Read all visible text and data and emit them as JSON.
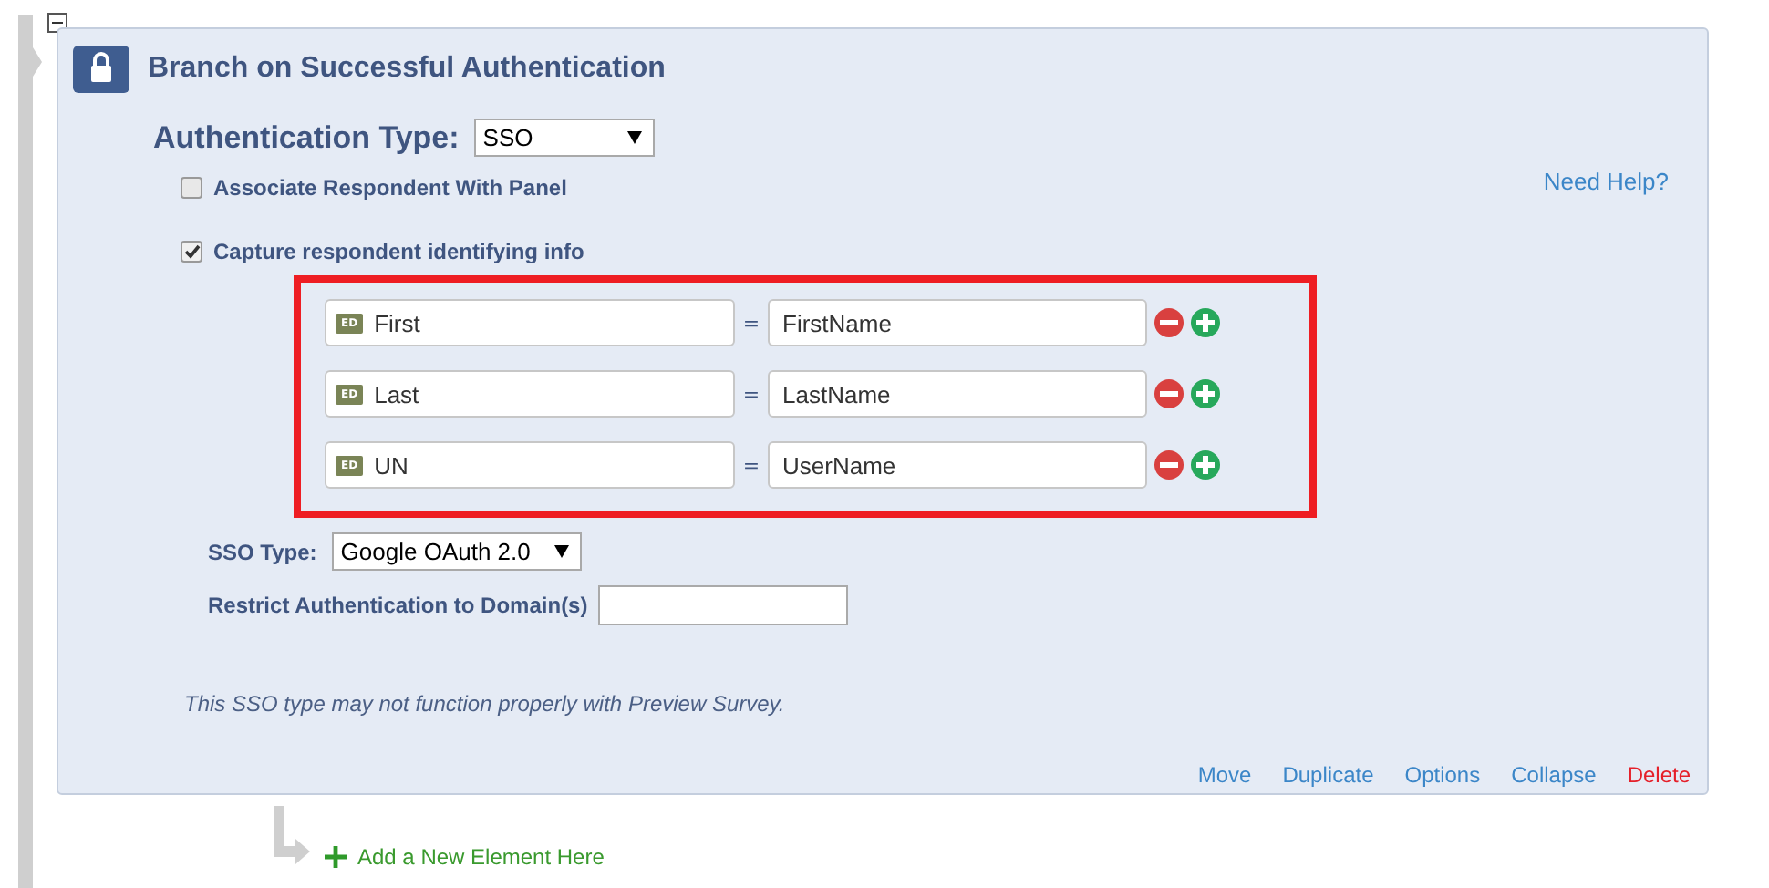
{
  "block": {
    "title": "Branch on Successful Authentication",
    "expanded": true,
    "authentication_type": {
      "label": "Authentication Type:",
      "value": "SSO"
    },
    "need_help": "Need Help?",
    "options": [
      {
        "label": "Associate Respondent With Panel",
        "checked": false
      },
      {
        "label": "Capture respondent identifying info",
        "checked": true
      }
    ],
    "mappings": [
      {
        "badge": "ED",
        "field": "First",
        "equals": "=",
        "value": "FirstName"
      },
      {
        "badge": "ED",
        "field": "Last",
        "equals": "=",
        "value": "LastName"
      },
      {
        "badge": "ED",
        "field": "UN",
        "equals": "=",
        "value": "UserName"
      }
    ],
    "sso_type": {
      "label": "SSO Type:",
      "value": "Google OAuth 2.0"
    },
    "restrict_domains": {
      "label": "Restrict Authentication to Domain(s)"
    },
    "note": "This SSO type may not function properly with Preview Survey.",
    "actions": [
      {
        "label": "Move",
        "kind": "normal"
      },
      {
        "label": "Duplicate",
        "kind": "normal"
      },
      {
        "label": "Options",
        "kind": "normal"
      },
      {
        "label": "Collapse",
        "kind": "normal"
      },
      {
        "label": "Delete",
        "kind": "danger"
      }
    ]
  },
  "add_element": "Add a New Element Here"
}
